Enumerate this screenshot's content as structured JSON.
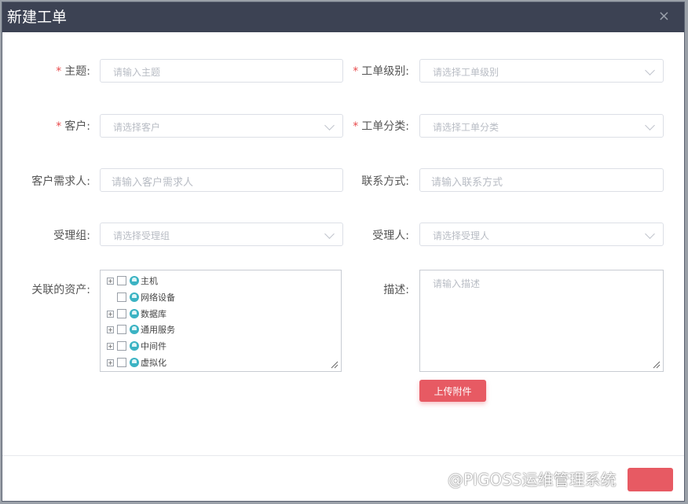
{
  "dialog": {
    "title": "新建工单",
    "close_symbol": "×"
  },
  "form": {
    "subject": {
      "label": "主题:",
      "required": "*",
      "placeholder": "请输入主题"
    },
    "level": {
      "label": "工单级别:",
      "required": "*",
      "placeholder": "请选择工单级别"
    },
    "customer": {
      "label": "客户:",
      "required": "*",
      "placeholder": "请选择客户"
    },
    "category": {
      "label": "工单分类:",
      "required": "*",
      "placeholder": "请选择工单分类"
    },
    "requester": {
      "label": "客户需求人:",
      "placeholder": "请输入客户需求人"
    },
    "contact": {
      "label": "联系方式:",
      "placeholder": "请输入联系方式"
    },
    "group": {
      "label": "受理组:",
      "placeholder": "请选择受理组"
    },
    "assignee": {
      "label": "受理人:",
      "placeholder": "请选择受理人"
    },
    "assets": {
      "label": "关联的资产:",
      "nodes": [
        {
          "expander": "+",
          "label": "主机"
        },
        {
          "expander": "",
          "label": "网络设备"
        },
        {
          "expander": "+",
          "label": "数据库"
        },
        {
          "expander": "+",
          "label": "通用服务"
        },
        {
          "expander": "+",
          "label": "中间件"
        },
        {
          "expander": "+",
          "label": "虚拟化"
        }
      ]
    },
    "description": {
      "label": "描述:",
      "placeholder": "请输入描述"
    },
    "upload_label": "上传附件"
  },
  "watermark": "@PIGOSS运维管理系统",
  "colors": {
    "header": "#3c4253",
    "accent": "#e75a63",
    "required": "#e8494a"
  }
}
